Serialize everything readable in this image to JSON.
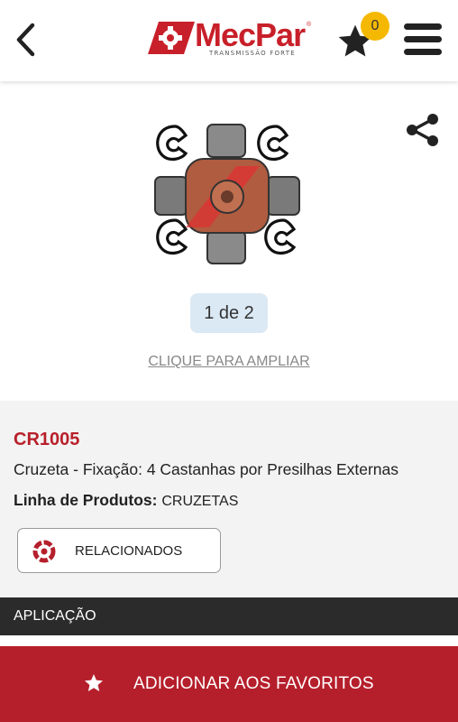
{
  "header": {
    "back_icon": "chevron-left-icon",
    "logo_text": "MecPar",
    "logo_reg": "®",
    "logo_subtitle": "TRANSMISSÃO FORTE",
    "favorites_icon": "star-icon",
    "favorites_count": "0",
    "menu_icon": "hamburger-menu-icon"
  },
  "gallery": {
    "share_icon": "share-icon",
    "image_alt": "Cruzeta universal joint",
    "pager": "1 de 2",
    "zoom_link": "CLIQUE PARA AMPLIAR"
  },
  "product": {
    "code": "CR1005",
    "description": "Cruzeta - Fixação: 4 Castanhas por Presilhas Externas",
    "line_label": "Linha de Produtos:",
    "line_value": "CRUZETAS",
    "related_label": "RELACIONADOS"
  },
  "application": {
    "label": "APLICAÇÃO"
  },
  "footer": {
    "add_favorite_label": "ADICIONAR AOS FAVORITOS"
  },
  "colors": {
    "brand_red": "#c8202a",
    "badge_yellow": "#f5b800",
    "dark_bar": "#2b2b2b",
    "footer_red": "#b51f2b"
  }
}
